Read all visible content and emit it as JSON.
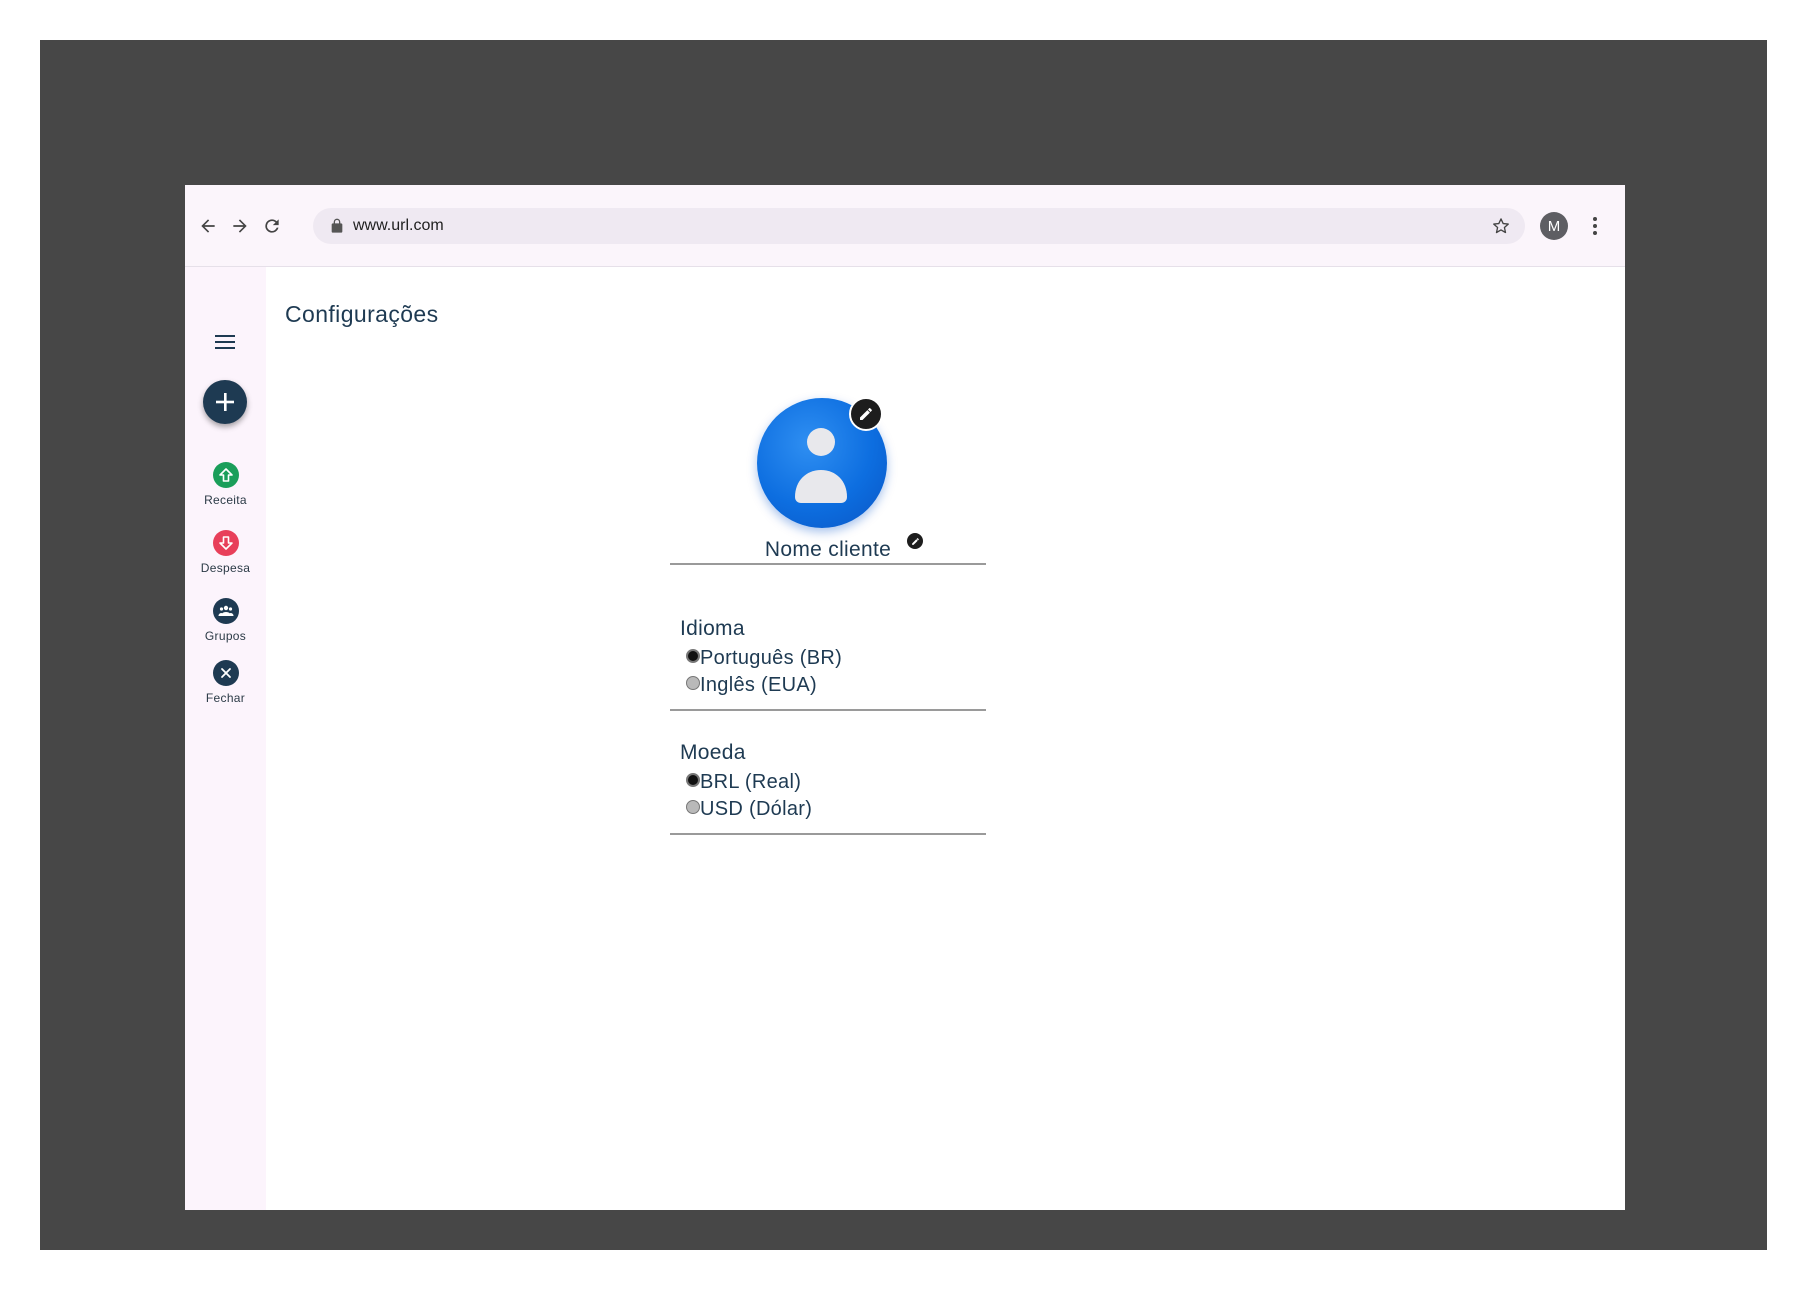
{
  "browser": {
    "url": "www.url.com",
    "profile_initial": "M"
  },
  "sidebar": {
    "items": [
      {
        "label": "Receita",
        "icon": "income-up-arrow-icon",
        "color": "#1a9e5a"
      },
      {
        "label": "Despesa",
        "icon": "expense-down-arrow-icon",
        "color": "#e83f5a"
      },
      {
        "label": "Grupos",
        "icon": "groups-icon",
        "color": "#1e3a52"
      },
      {
        "label": "Fechar",
        "icon": "close-icon",
        "color": "#1e3a52"
      }
    ]
  },
  "main": {
    "title": "Configurações",
    "profile": {
      "name": "Nome cliente"
    },
    "language": {
      "heading": "Idioma",
      "options": [
        {
          "label": "Português (BR)",
          "checked": true
        },
        {
          "label": "Inglês (EUA)",
          "checked": false
        }
      ]
    },
    "currency": {
      "heading": "Moeda",
      "options": [
        {
          "label": "BRL (Real)",
          "checked": true
        },
        {
          "label": "USD (Dólar)",
          "checked": false
        }
      ]
    }
  },
  "colors": {
    "primary": "#1e3a52",
    "income": "#1a9e5a",
    "expense": "#e83f5a",
    "avatar_blue": "#0d6ee0"
  }
}
